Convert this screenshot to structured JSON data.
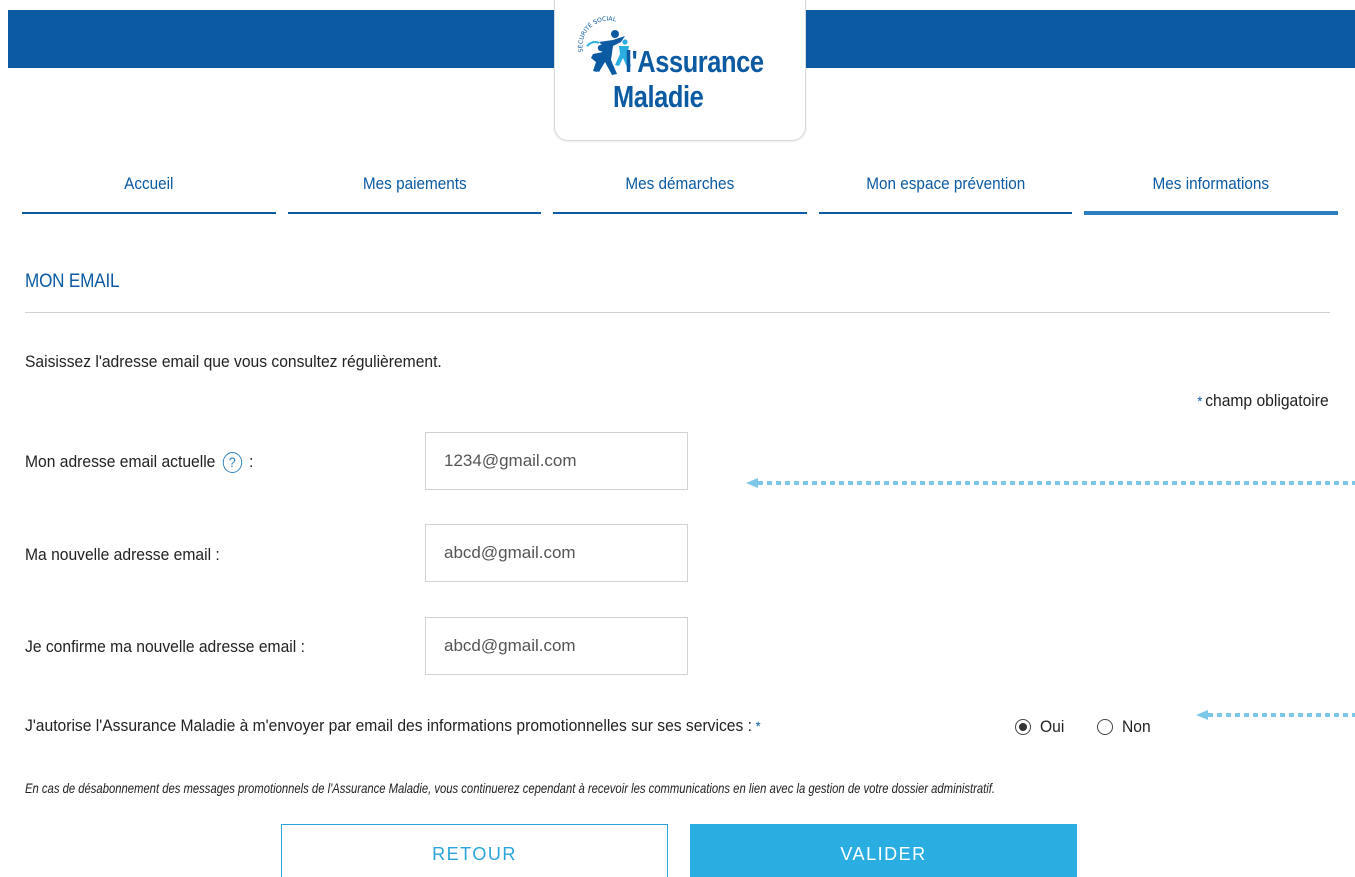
{
  "brand": {
    "line1": "l'Assurance",
    "line2": "Maladie",
    "emblem_text": "SÉCURITÉ SOCIALE",
    "color_primary": "#0b5aa2",
    "color_accent": "#2aaee2"
  },
  "nav": {
    "tabs": [
      {
        "label": "Accueil",
        "active": false
      },
      {
        "label": "Mes paiements",
        "active": false
      },
      {
        "label": "Mes démarches",
        "active": false
      },
      {
        "label": "Mon espace prévention",
        "active": false
      },
      {
        "label": "Mes informations",
        "active": true
      }
    ]
  },
  "section": {
    "title": "MON EMAIL",
    "intro": "Saisissez l'adresse email que vous consultez régulièrement.",
    "required_star": "*",
    "required_note": "champ obligatoire"
  },
  "form": {
    "current_email": {
      "label": "Mon adresse email actuelle",
      "suffix": ":",
      "help_icon": "?",
      "value": "1234@gmail.com"
    },
    "new_email": {
      "label": "Ma nouvelle adresse email :",
      "value": "abcd@gmail.com"
    },
    "confirm_email": {
      "label": "Je confirme ma nouvelle adresse email :",
      "value": "abcd@gmail.com"
    },
    "consent": {
      "label": "J'autorise l'Assurance Maladie à m'envoyer par email des informations promotionnelles sur ses services :",
      "required_star": "*",
      "options": [
        {
          "label": "Oui",
          "selected": true
        },
        {
          "label": "Non",
          "selected": false
        }
      ]
    },
    "disclaimer": "En cas de désabonnement des messages promotionnels de l'Assurance Maladie, vous continuerez cependant à recevoir les communications en lien avec la gestion de votre dossier administratif."
  },
  "buttons": {
    "back": "RETOUR",
    "submit": "VALIDER"
  }
}
